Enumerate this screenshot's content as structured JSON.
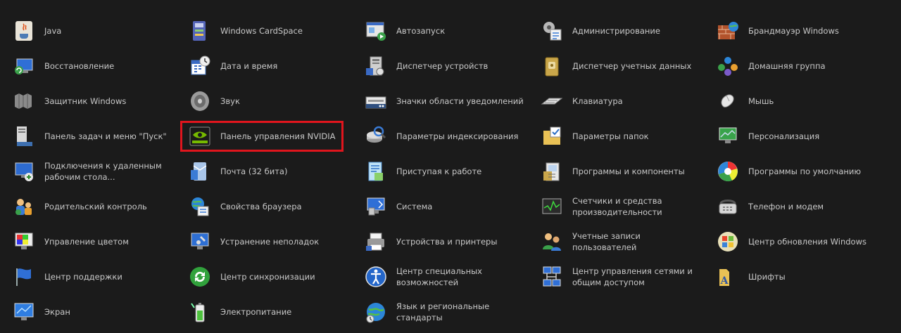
{
  "colors": {
    "background": "#1b1b1b",
    "text": "#c8c8c8",
    "highlight": "#e0151d"
  },
  "highlighted_item": "Панель управления NVIDIA",
  "items": [
    {
      "label": "Java",
      "icon": "java-icon"
    },
    {
      "label": "Восстановление",
      "icon": "recovery-icon"
    },
    {
      "label": "Защитник Windows",
      "icon": "defender-icon"
    },
    {
      "label": "Панель задач и меню \"Пуск\"",
      "icon": "taskbar-icon"
    },
    {
      "label": "Подключения к удаленным рабочим стола...",
      "icon": "remote-desktop-icon"
    },
    {
      "label": "Родительский контроль",
      "icon": "parental-control-icon"
    },
    {
      "label": "Управление цветом",
      "icon": "color-management-icon"
    },
    {
      "label": "Центр поддержки",
      "icon": "action-center-flag-icon"
    },
    {
      "label": "Экран",
      "icon": "display-icon"
    },
    {
      "label": "Windows CardSpace",
      "icon": "cardspace-icon"
    },
    {
      "label": "Дата и время",
      "icon": "date-time-icon"
    },
    {
      "label": "Звук",
      "icon": "sound-icon"
    },
    {
      "label": "Панель управления NVIDIA",
      "icon": "nvidia-icon"
    },
    {
      "label": "Почта (32 бита)",
      "icon": "mail-icon"
    },
    {
      "label": "Свойства браузера",
      "icon": "internet-options-icon"
    },
    {
      "label": "Устранение неполадок",
      "icon": "troubleshooting-icon"
    },
    {
      "label": "Центр синхронизации",
      "icon": "sync-center-icon"
    },
    {
      "label": "Электропитание",
      "icon": "power-options-icon"
    },
    {
      "label": "Автозапуск",
      "icon": "autoplay-icon"
    },
    {
      "label": "Диспетчер устройств",
      "icon": "device-manager-icon"
    },
    {
      "label": "Значки области уведомлений",
      "icon": "notification-area-icon"
    },
    {
      "label": "Параметры индексирования",
      "icon": "indexing-icon"
    },
    {
      "label": "Приступая к работе",
      "icon": "getting-started-icon"
    },
    {
      "label": "Система",
      "icon": "system-icon"
    },
    {
      "label": "Устройства и принтеры",
      "icon": "devices-printers-icon"
    },
    {
      "label": "Центр специальных возможностей",
      "icon": "ease-of-access-icon"
    },
    {
      "label": "Язык и региональные стандарты",
      "icon": "region-language-icon"
    },
    {
      "label": "Администрирование",
      "icon": "admin-tools-icon"
    },
    {
      "label": "Диспетчер учетных данных",
      "icon": "credential-manager-icon"
    },
    {
      "label": "Клавиатура",
      "icon": "keyboard-icon"
    },
    {
      "label": "Параметры папок",
      "icon": "folder-options-icon"
    },
    {
      "label": "Программы и компоненты",
      "icon": "programs-features-icon"
    },
    {
      "label": "Счетчики и средства производительности",
      "icon": "performance-icon"
    },
    {
      "label": "Учетные записи пользователей",
      "icon": "user-accounts-icon"
    },
    {
      "label": "Центр управления сетями и общим доступом",
      "icon": "network-center-icon"
    },
    {
      "label": "",
      "icon": ""
    },
    {
      "label": "Брандмауэр Windows",
      "icon": "firewall-icon"
    },
    {
      "label": "Домашняя группа",
      "icon": "homegroup-icon"
    },
    {
      "label": "Мышь",
      "icon": "mouse-icon"
    },
    {
      "label": "Персонализация",
      "icon": "personalization-icon"
    },
    {
      "label": "Программы по умолчанию",
      "icon": "default-programs-icon"
    },
    {
      "label": "Телефон и модем",
      "icon": "phone-modem-icon"
    },
    {
      "label": "Центр обновления Windows",
      "icon": "windows-update-icon"
    },
    {
      "label": "Шрифты",
      "icon": "fonts-icon"
    },
    {
      "label": "",
      "icon": ""
    }
  ]
}
